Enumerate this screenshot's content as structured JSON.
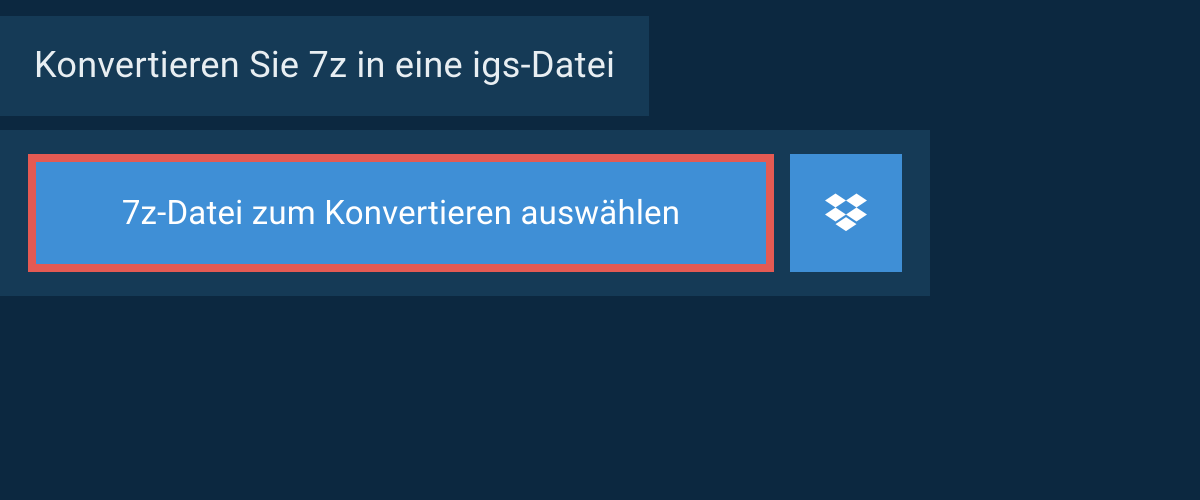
{
  "header": {
    "title": "Konvertieren Sie 7z in eine igs-Datei"
  },
  "actions": {
    "select_label": "7z-Datei zum Konvertieren auswählen",
    "dropbox_icon": "dropbox"
  },
  "colors": {
    "page_bg": "#0c2840",
    "panel_bg": "#153a56",
    "button_bg": "#3f8fd6",
    "highlight_border": "#e45a53",
    "text_light": "#e8eef2"
  }
}
